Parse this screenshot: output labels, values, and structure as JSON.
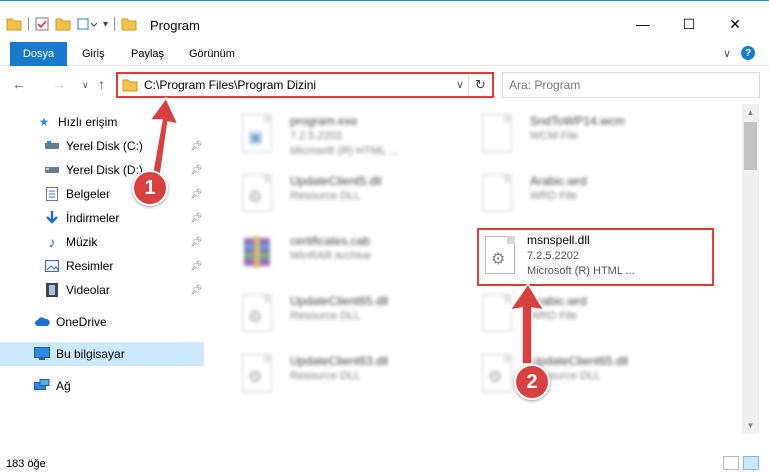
{
  "window": {
    "title": "Program",
    "minimize": "—",
    "maximize": "☐",
    "close": "✕"
  },
  "ribbon": {
    "file_tab": "Dosya",
    "tabs": [
      "Giriş",
      "Paylaş",
      "Görünüm"
    ],
    "expand": "∨",
    "help": "?"
  },
  "address": {
    "path": "C:\\Program Files\\Program Dizini",
    "dropdown": "∨",
    "refresh": "↻",
    "search_placeholder": "Ara: Program"
  },
  "nav": {
    "quick_access": "Hızlı erişim",
    "items": [
      {
        "label": "Yerel Disk (C:)",
        "icon": "drive-icon",
        "pinned": true
      },
      {
        "label": "Yerel Disk (D:)",
        "icon": "drive-icon",
        "pinned": true
      },
      {
        "label": "Belgeler",
        "icon": "documents-icon",
        "pinned": true
      },
      {
        "label": "İndirmeler",
        "icon": "download-icon",
        "pinned": true
      },
      {
        "label": "Müzik",
        "icon": "music-icon",
        "pinned": true
      },
      {
        "label": "Resimler",
        "icon": "pictures-icon",
        "pinned": true
      },
      {
        "label": "Videolar",
        "icon": "video-icon",
        "pinned": true
      }
    ],
    "onedrive": "OneDrive",
    "this_pc": "Bu bilgisayar",
    "network": "Ağ"
  },
  "files": {
    "left": [
      {
        "name": "program.exe",
        "line2": "7.2.5.2202",
        "line3": "Microsoft (R) HTML ..."
      },
      {
        "name": "UpdateClient5.dll",
        "line2": "Resource DLL",
        "line3": ""
      },
      {
        "name": "certificates.cab",
        "line2": "WinRAR Archive",
        "line3": ""
      },
      {
        "name": "UpdateClient65.dll",
        "line2": "Resource DLL",
        "line3": ""
      },
      {
        "name": "UpdateClient63.dll",
        "line2": "Resource DLL",
        "line3": ""
      }
    ],
    "right": [
      {
        "name": "SndToWP14.wcm",
        "line2": "WCM File",
        "line3": ""
      },
      {
        "name": "Arabic.wrd",
        "line2": "WRD File",
        "line3": ""
      },
      {
        "name": "Arabic.wrd",
        "line2": "WRD File",
        "line3": ""
      },
      {
        "name": "UpdateClient65.dll",
        "line2": "Resource DLL",
        "line3": ""
      }
    ],
    "highlighted": {
      "name": "msnspell.dll",
      "line2": "7.2.5.2202",
      "line3": "Microsoft (R) HTML ..."
    }
  },
  "status": {
    "count": "183 öğe"
  },
  "annotations": {
    "badge1": "1",
    "badge2": "2",
    "color": "#d94040"
  }
}
